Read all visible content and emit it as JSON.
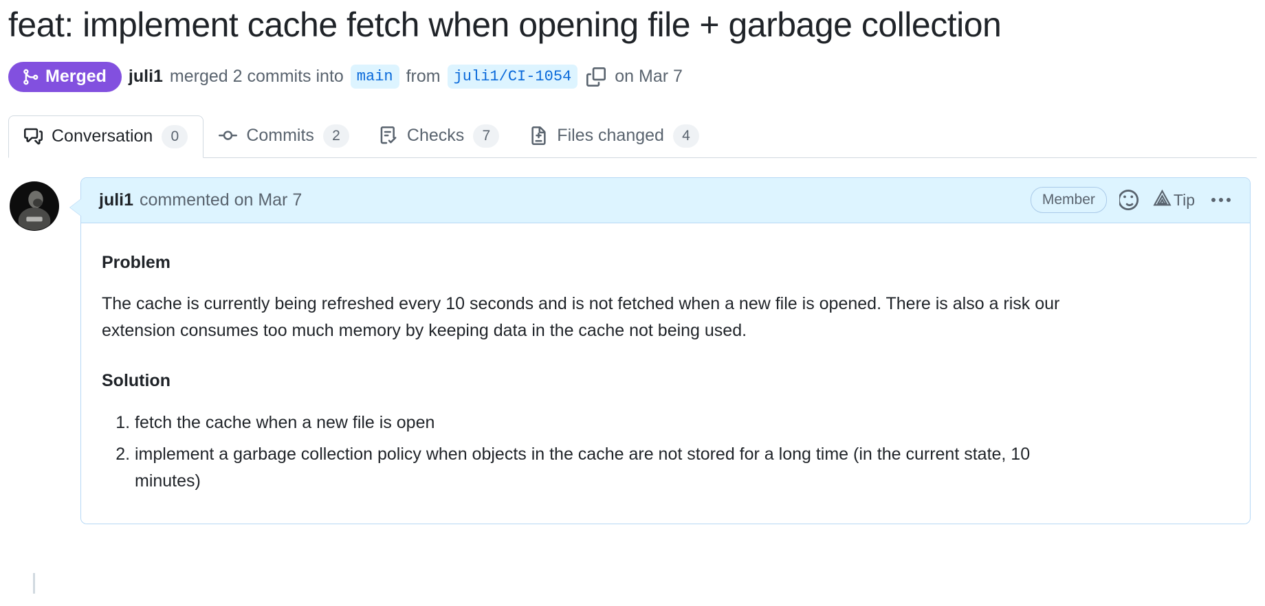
{
  "pull_request": {
    "title": "feat: implement cache fetch when opening file + garbage collection",
    "state_label": "Merged",
    "state_color": "#8250df",
    "meta": {
      "actor": "juli1",
      "merged_text": "merged 2 commits into",
      "base_branch": "main",
      "from_text": "from",
      "head_branch": "juli1/CI-1054",
      "date_text": "on Mar 7",
      "copy_icon": "copy-icon"
    }
  },
  "tabs": [
    {
      "label": "Conversation",
      "count": "0",
      "icon": "comment-discussion-icon",
      "selected": true
    },
    {
      "label": "Commits",
      "count": "2",
      "icon": "git-commit-icon",
      "selected": false
    },
    {
      "label": "Checks",
      "count": "7",
      "icon": "checklist-icon",
      "selected": false
    },
    {
      "label": "Files changed",
      "count": "4",
      "icon": "file-diff-icon",
      "selected": false
    }
  ],
  "comment": {
    "author": "juli1",
    "when": "commented on Mar 7",
    "badge": "Member",
    "reaction_icon": "smiley-icon",
    "tip_label": "Tip",
    "tip_icon": "triangle-tip-icon",
    "menu_icon": "kebab-menu-icon",
    "avatar_alt": "juli1 avatar",
    "body": {
      "heading_problem": "Problem",
      "paragraph_problem": "The cache is currently being refreshed every 10 seconds and is not fetched when a new file is opened. There is also a risk our extension consumes too much memory by keeping data in the cache not being used.",
      "heading_solution": "Solution",
      "list": [
        "fetch the cache when a new file is open",
        "implement a garbage collection policy when objects in the cache are not stored for a long time (in the current state, 10 minutes)"
      ]
    }
  },
  "colors": {
    "merged_purple": "#8250df",
    "link_blue": "#0969da",
    "chip_bg": "#ddf4ff",
    "border_blue": "#b6d8f5",
    "border_gray": "#d1d9e0",
    "text_muted": "#59636e",
    "text_default": "#1f2328"
  }
}
